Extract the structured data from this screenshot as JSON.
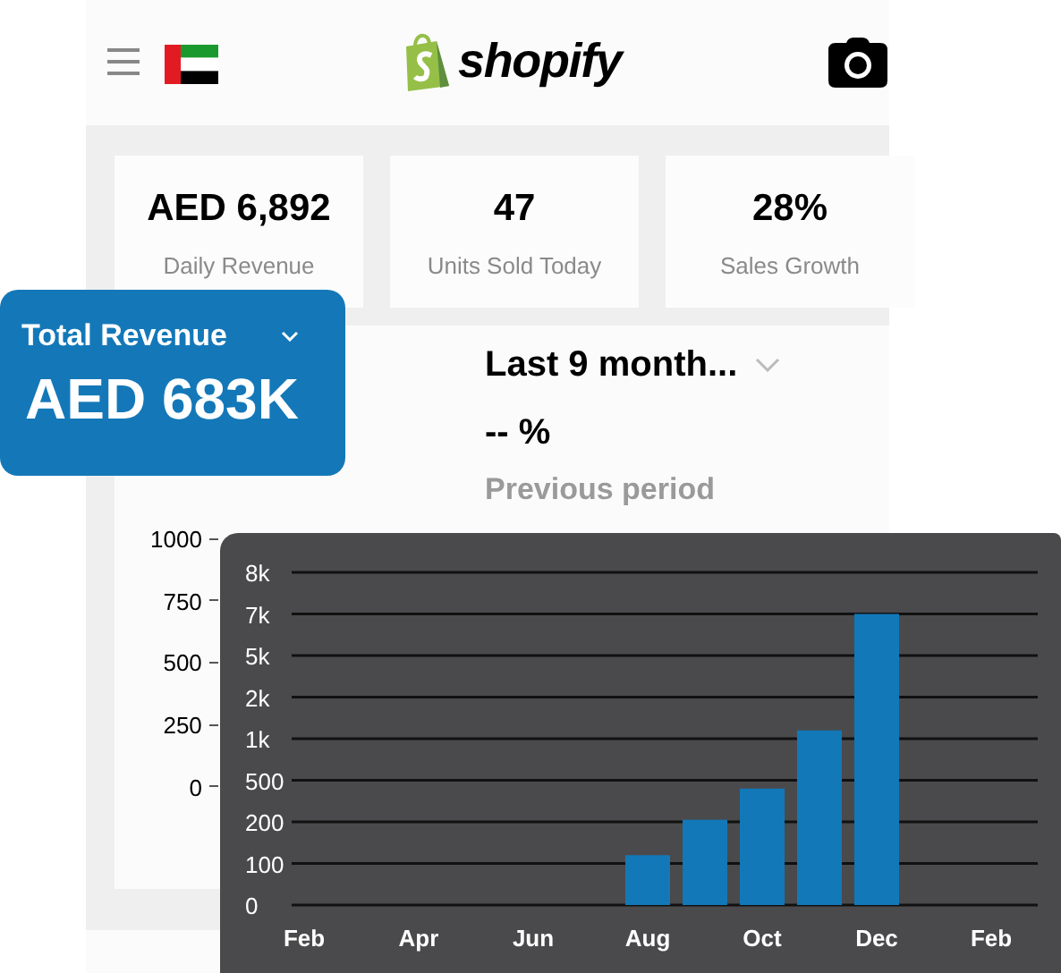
{
  "header": {
    "logo_text": "shopify"
  },
  "stats": [
    {
      "value": "AED 6,892",
      "label": "Daily Revenue"
    },
    {
      "value": "47",
      "label": "Units Sold Today"
    },
    {
      "value": "28%",
      "label": "Sales Growth"
    }
  ],
  "total_revenue_card": {
    "title": "Total Revenue",
    "value": "AED 683K"
  },
  "period": {
    "selector": "Last 9 month...",
    "change": "-- %",
    "caption": "Previous period"
  },
  "background_chart_axis": [
    "1000",
    "750",
    "500",
    "250",
    "0"
  ],
  "revenue_chart": {
    "y_labels": [
      "8k",
      "7k",
      "5k",
      "2k",
      "1k",
      "500",
      "200",
      "100",
      "0"
    ],
    "x_labels": [
      "Feb",
      "Apr",
      "Jun",
      "Aug",
      "Oct",
      "Dec",
      "Feb"
    ]
  }
}
